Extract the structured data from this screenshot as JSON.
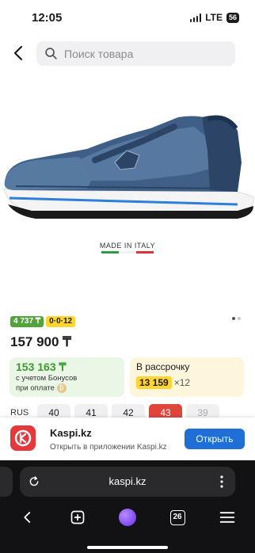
{
  "status": {
    "time": "12:05",
    "network": "LTE",
    "battery": "56"
  },
  "search": {
    "placeholder": "Поиск товара"
  },
  "product": {
    "made_in": "MADE IN ITALY",
    "badge_price": "4 737 ₸",
    "badge_installment": "0·0·12",
    "price": "157 900 ₸"
  },
  "bonus": {
    "amount": "153 163 ₸",
    "note_line1": "с учетом Бонусов",
    "note_line2": "при оплате"
  },
  "installment": {
    "title": "В рассрочку",
    "amount": "13 159",
    "multiplier": "×12"
  },
  "sizes": {
    "label": "RUS",
    "items": [
      {
        "value": "40",
        "state": "normal"
      },
      {
        "value": "41",
        "state": "normal"
      },
      {
        "value": "42",
        "state": "normal"
      },
      {
        "value": "43",
        "state": "selected"
      },
      {
        "value": "39",
        "state": "disabled"
      }
    ]
  },
  "banner": {
    "title": "Kaspi.kz",
    "subtitle": "Открыть в приложении Kaspi.kz",
    "button": "Открыть"
  },
  "browser": {
    "url": "kaspi.kz",
    "tab_count": "26"
  },
  "colors": {
    "accent_red": "#e0453b",
    "kaspi_red": "#e5383b",
    "open_button": "#1f6fd6",
    "bonus_green": "#3a9b2f",
    "yellow": "#ffd631"
  }
}
